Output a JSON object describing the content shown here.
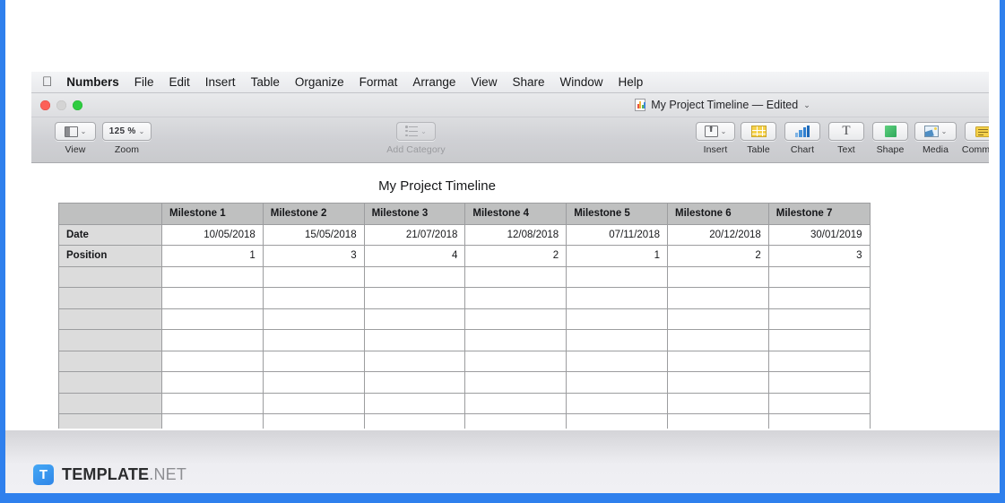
{
  "brand": {
    "accent": "#2f80ed",
    "logo_letter": "T",
    "logo_main": "TEMPLATE",
    "logo_suffix": ".NET"
  },
  "menubar": {
    "apple_icon": "apple-icon",
    "items": [
      {
        "label": "Numbers",
        "app": true
      },
      {
        "label": "File"
      },
      {
        "label": "Edit"
      },
      {
        "label": "Insert"
      },
      {
        "label": "Table"
      },
      {
        "label": "Organize"
      },
      {
        "label": "Format"
      },
      {
        "label": "Arrange"
      },
      {
        "label": "View"
      },
      {
        "label": "Share"
      },
      {
        "label": "Window"
      },
      {
        "label": "Help"
      }
    ]
  },
  "titlebar": {
    "doc_icon": "numbers-document-icon",
    "title": "My Project Timeline — Edited",
    "chevron": "⌄",
    "lights": {
      "close": "close-button",
      "minimize": "minimize-button",
      "zoom": "maximize-button"
    }
  },
  "toolbar": {
    "view": {
      "label": "View",
      "icon": "view-panel-icon",
      "chevron": "⌄"
    },
    "zoom": {
      "label": "Zoom",
      "value": "125 %",
      "chevron": "⌄"
    },
    "add_category": {
      "label": "Add Category",
      "icon": "list-icon",
      "chevron": "⌄",
      "disabled": true
    },
    "insert": {
      "label": "Insert",
      "icon": "insert-object-icon",
      "chevron": "⌄"
    },
    "table": {
      "label": "Table",
      "icon": "table-icon"
    },
    "chart": {
      "label": "Chart",
      "icon": "chart-bars-icon"
    },
    "text": {
      "label": "Text",
      "icon": "text-T-icon"
    },
    "shape": {
      "label": "Shape",
      "icon": "shape-square-icon"
    },
    "media": {
      "label": "Media",
      "icon": "media-photo-icon",
      "chevron": "⌄"
    },
    "comment": {
      "label": "Comment",
      "icon": "comment-note-icon"
    }
  },
  "sheet": {
    "title": "My Project Timeline",
    "column_headers": [
      "",
      "Milestone 1",
      "Milestone 2",
      "Milestone 3",
      "Milestone 4",
      "Milestone 5",
      "Milestone 6",
      "Milestone 7"
    ],
    "rows": [
      {
        "label": "Date",
        "values": [
          "10/05/2018",
          "15/05/2018",
          "21/07/2018",
          "12/08/2018",
          "07/11/2018",
          "20/12/2018",
          "30/01/2019"
        ]
      },
      {
        "label": "Position",
        "values": [
          "1",
          "3",
          "4",
          "2",
          "1",
          "2",
          "3"
        ]
      },
      {
        "label": "",
        "values": [
          "",
          "",
          "",
          "",
          "",
          "",
          ""
        ]
      },
      {
        "label": "",
        "values": [
          "",
          "",
          "",
          "",
          "",
          "",
          ""
        ]
      },
      {
        "label": "",
        "values": [
          "",
          "",
          "",
          "",
          "",
          "",
          ""
        ]
      },
      {
        "label": "",
        "values": [
          "",
          "",
          "",
          "",
          "",
          "",
          ""
        ]
      },
      {
        "label": "",
        "values": [
          "",
          "",
          "",
          "",
          "",
          "",
          ""
        ]
      },
      {
        "label": "",
        "values": [
          "",
          "",
          "",
          "",
          "",
          "",
          ""
        ]
      },
      {
        "label": "",
        "values": [
          "",
          "",
          "",
          "",
          "",
          "",
          ""
        ]
      },
      {
        "label": "",
        "values": [
          "",
          "",
          "",
          "",
          "",
          "",
          ""
        ]
      },
      {
        "label": "",
        "values": [
          "",
          "",
          "",
          "",
          "",
          "",
          ""
        ]
      }
    ]
  },
  "chart_data": {
    "type": "table",
    "title": "My Project Timeline",
    "categories": [
      "Milestone 1",
      "Milestone 2",
      "Milestone 3",
      "Milestone 4",
      "Milestone 5",
      "Milestone 6",
      "Milestone 7"
    ],
    "series": [
      {
        "name": "Date",
        "values": [
          "10/05/2018",
          "15/05/2018",
          "21/07/2018",
          "12/08/2018",
          "07/11/2018",
          "20/12/2018",
          "30/01/2019"
        ]
      },
      {
        "name": "Position",
        "values": [
          1,
          3,
          4,
          2,
          1,
          2,
          3
        ]
      }
    ]
  }
}
